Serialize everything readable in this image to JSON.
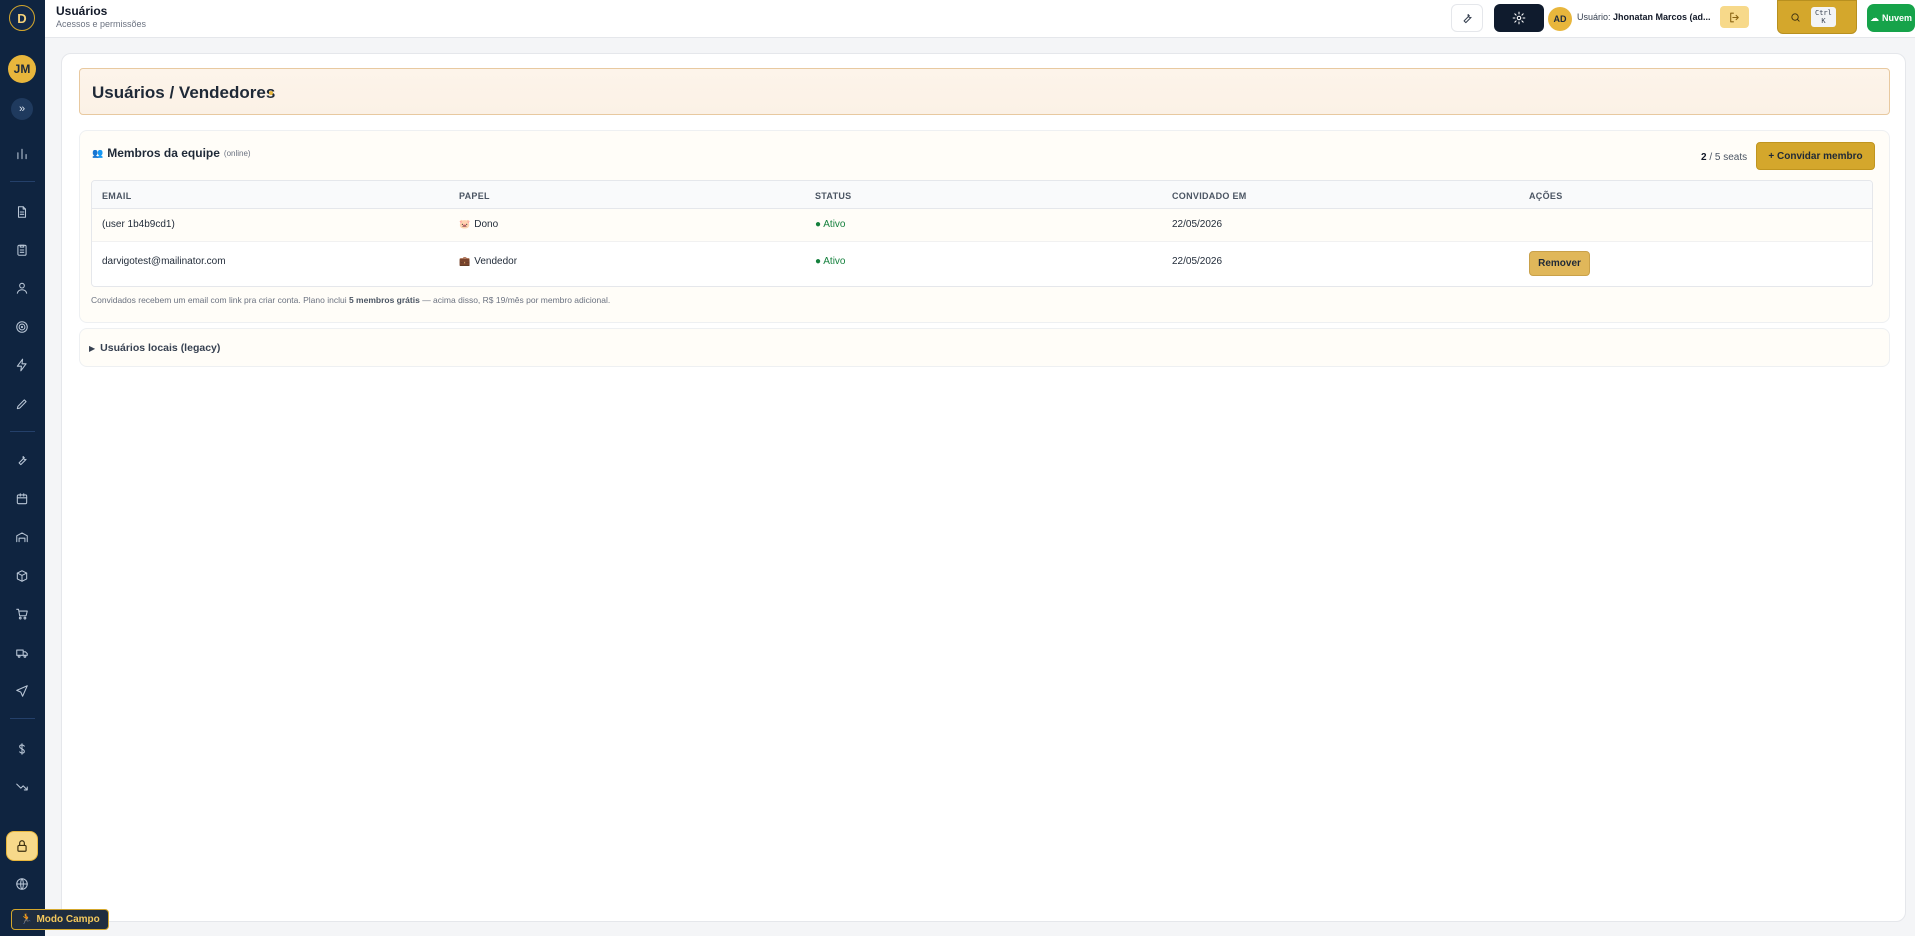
{
  "sidebar": {
    "logo": "D",
    "avatar": "JM",
    "expand": "»",
    "icons": [
      "chart-icon",
      "file-icon",
      "clipboard-icon",
      "user-icon",
      "target-icon",
      "lightning-icon",
      "pencil-icon",
      "wrench-icon",
      "calendar-icon",
      "warehouse-icon",
      "box-icon",
      "cart-icon",
      "truck-icon",
      "send-icon",
      "dollar-icon",
      "trending-down-icon",
      "lock-icon",
      "globe-icon"
    ],
    "modo_campo": "Modo Campo"
  },
  "topbar": {
    "title": "Usuários",
    "subtitle": "Acessos e permissões",
    "avatar": "AD",
    "user_prefix": "Usuário:",
    "user_name": "Jhonatan Marcos (ad...",
    "shortcut": "Ctrl\nK",
    "cloud_label": "Nuvem"
  },
  "header": {
    "title": "Usuários / Vendedores"
  },
  "team": {
    "title": "Membros da equipe",
    "online": "(online)",
    "seats_used": "2",
    "seats_total": "/ 5 seats",
    "invite_label": "+ Convidar membro",
    "columns": [
      "EMAIL",
      "PAPEL",
      "STATUS",
      "CONVIDADO EM",
      "AÇÕES"
    ],
    "rows": [
      {
        "email": "(user 1b4b9cd1)",
        "role_icon": "🐷",
        "role": "Dono",
        "status": "● Ativo",
        "invited": "22/05/2026",
        "action": ""
      },
      {
        "email": "darvigotest@mailinator.com",
        "role_icon": "💼",
        "role": "Vendedor",
        "status": "● Ativo",
        "invited": "22/05/2026",
        "action": "Remover"
      }
    ],
    "note_pre": "Convidados recebem um email com link pra criar conta. Plano inclui ",
    "note_bold": "5 membros grátis",
    "note_post": " — acima disso, R$ 19/mês por membro adicional."
  },
  "legacy": {
    "label": "Usuários locais (legacy)"
  },
  "colors": {
    "sidebar": "#0f2440",
    "accent_gold": "#d4a72c",
    "status_green": "#15803d",
    "cloud_green": "#16a34a"
  }
}
